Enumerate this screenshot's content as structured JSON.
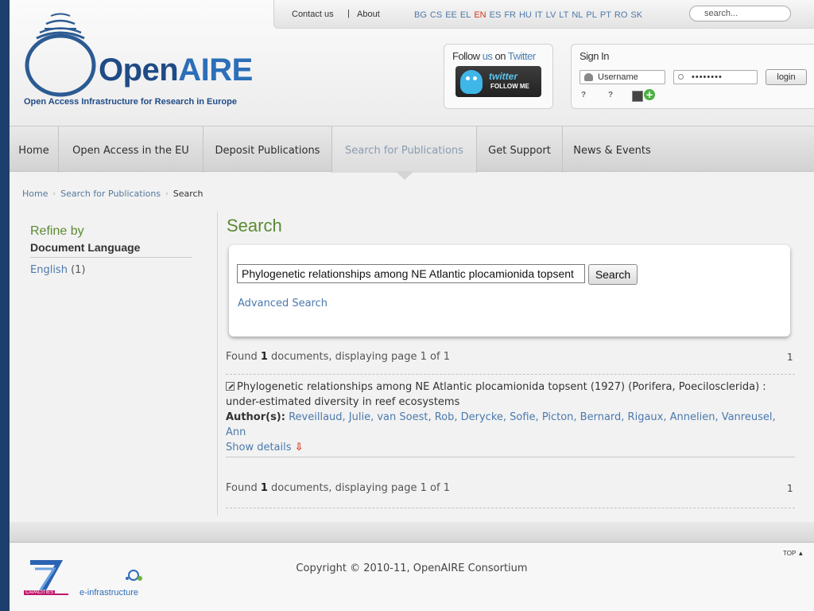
{
  "header": {
    "logo_open": "Open",
    "logo_aire": "AIRE",
    "tagline": "Open Access Infrastructure for Research in Europe",
    "contact_label": "Contact us",
    "separator": "|",
    "about_label": "About",
    "languages": [
      "BG",
      "CS",
      "EE",
      "EL",
      "EN",
      "ES",
      "FR",
      "HU",
      "IT",
      "LV",
      "LT",
      "NL",
      "PL",
      "PT",
      "RO",
      "SK"
    ],
    "active_language": "EN",
    "search_placeholder": "search..."
  },
  "twitter": {
    "title_follow": "Follow ",
    "title_us": "us",
    "title_on": " on ",
    "title_twitter": "Twitter",
    "button_word": "twitter",
    "button_follow": "FOLLOW ME"
  },
  "signin": {
    "title": "Sign In",
    "username_placeholder": "Username",
    "password_value": "••••••••",
    "login_label": "login",
    "help_1": "?",
    "help_2": "?"
  },
  "nav": {
    "items": [
      {
        "label": "Home"
      },
      {
        "label": "Open Access in the EU"
      },
      {
        "label": "Deposit Publications"
      },
      {
        "label": "Search for Publications"
      },
      {
        "label": "Get Support"
      },
      {
        "label": "News & Events"
      }
    ],
    "current": "Search for Publications"
  },
  "breadcrumb": {
    "home": "Home",
    "sep": "›",
    "section": "Search for Publications",
    "current": "Search"
  },
  "sidebar": {
    "refine_title": "Refine by",
    "group_title": "Document Language",
    "facet_label": "English",
    "facet_count": "(1)"
  },
  "main": {
    "heading": "Search",
    "query_value": "Phylogenetic relationships among NE Atlantic plocamionida topsent",
    "search_button": "Search",
    "advanced_link": "Advanced Search",
    "found_prefix": "Found ",
    "found_count": "1",
    "found_suffix": " documents, displaying page 1 of 1",
    "page_number": "1"
  },
  "result": {
    "title": "Phylogenetic relationships among NE Atlantic plocamionida topsent (1927) (Porifera, Poecilosclerida) : under-estimated diversity in reef ecosystems",
    "authors_label": "Author(s):",
    "authors": "Reveillaud, Julie, van Soest, Rob, Derycke, Sofie, Picton, Bernard, Rigaux, Annelien, Vanreusel, Ann",
    "show_details": "Show details",
    "details_arrow": "⇩"
  },
  "footer": {
    "top_label": "TOP ▲",
    "copyright": "Copyright © 2010-11, OpenAIRE Consortium",
    "capacities": "CAPACITIES",
    "einfra": "e-infrastructure"
  },
  "colors": {
    "brand_blue": "#1f4b86",
    "link_blue": "#4a79ad",
    "heading_green": "#5b8a33",
    "active_lang_red": "#d8341c",
    "page_background": "#1d3f6e"
  }
}
